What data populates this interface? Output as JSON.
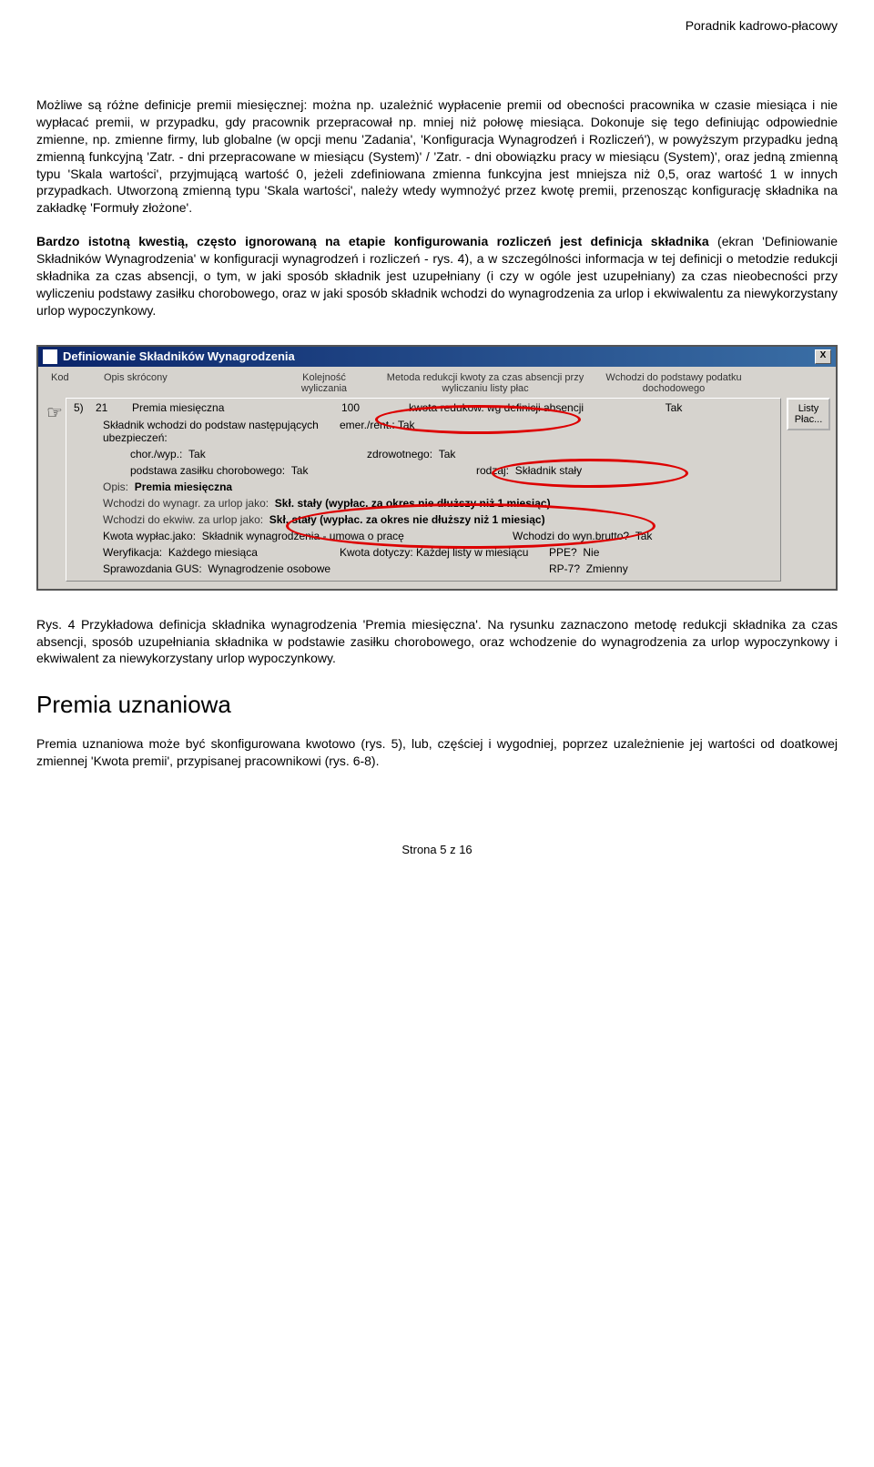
{
  "header": {
    "right": "Poradnik kadrowo-płacowy"
  },
  "para1": "Możliwe są różne definicje premii miesięcznej: można np. uzależnić wypłacenie premii od obecności pracownika w czasie miesiąca i nie wypłacać premii, w przypadku, gdy pracownik przepracował np. mniej niż połowę miesiąca. Dokonuje się tego definiując odpowiednie zmienne, np. zmienne firmy, lub globalne (w opcji menu 'Zadania', 'Konfiguracja Wynagrodzeń i Rozliczeń'), w powyższym przypadku jedną zmienną funkcyjną 'Zatr. - dni przepracowane w miesiącu (System)' / 'Zatr. - dni obowiązku pracy w miesiącu (System)', oraz jedną zmienną typu 'Skala wartości', przyjmującą wartość 0, jeżeli zdefiniowana zmienna funkcyjna jest mniejsza niż 0,5, oraz wartość 1 w innych przypadkach. Utworzoną zmienną typu 'Skala wartości', należy wtedy wymnożyć przez kwotę premii, przenosząc konfigurację składnika na zakładkę 'Formuły złożone'.",
  "para2_b": "Bardzo istotną kwestią, często ignorowaną na etapie konfigurowania rozliczeń jest definicja składnika",
  "para2_r": " (ekran 'Definiowanie Składników Wynagrodzenia' w konfiguracji wynagrodzeń i rozliczeń - rys. 4), a w szczególności informacja w tej definicji o metodzie redukcji składnika za czas absencji, o tym, w jaki sposób składnik jest uzupełniany (i czy w ogóle jest uzupełniany) za czas nieobecności przy wyliczeniu podstawy zasiłku chorobowego, oraz w jaki sposób składnik wchodzi do wynagrodzenia za urlop i ekwiwalentu za niewykorzystany urlop wypoczynkowy.",
  "win": {
    "title": "Definiowanie Składników Wynagrodzenia",
    "sys_close": "X",
    "cols": {
      "c1": "Kod",
      "c2": "Opis skrócony",
      "c3": "Kolejność wyliczania",
      "c4": "Metoda redukcji kwoty za czas absencji przy wyliczaniu listy płac",
      "c5": "Wchodzi do podstawy podatku dochodowego"
    },
    "row": {
      "idx": "5)",
      "kod": "21",
      "opis": "Premia miesięczna",
      "kol": "100",
      "met": "kwota redukow. wg definicji absencji",
      "pod": "Tak"
    },
    "l_ubez": "Składnik wchodzi do podstaw następujących ubezpieczeń:",
    "l_emer": "emer./rent.:",
    "v_emer": "Tak",
    "l_chor": "chor./wyp.:",
    "v_chor": "Tak",
    "l_zdr": "zdrowotnego:",
    "v_zdr": "Tak",
    "l_podst": "podstawa zasiłku chorobowego:",
    "v_podst": "Tak",
    "l_rodz": "rodzaj:",
    "v_rodz": "Składnik stały",
    "l_opis": "Opis:",
    "v_opis": "Premia miesięczna",
    "l_wurl": "Wchodzi do wynagr. za urlop jako:",
    "v_wurl": "Skł. stały (wypłac. za okres nie dłuższy niż 1 miesiąc)",
    "l_wekw": "Wchodzi do ekwiw. za urlop jako:",
    "v_wekw": "Skł. stały (wypłac. za okres nie dłuższy niż 1 miesiąc)",
    "l_kwyp": "Kwota wypłac.jako:",
    "v_kwyp": "Składnik wynagrodzenia - umowa o pracę",
    "l_wbr": "Wchodzi do wyn.brutto?",
    "v_wbr": "Tak",
    "l_wer": "Weryfikacja:",
    "v_wer": "Każdego miesiąca",
    "l_kwd": "Kwota dotyczy:",
    "v_kwd": "Każdej listy w miesiącu",
    "l_ppe": "PPE?",
    "v_ppe": "Nie",
    "l_gus": "Sprawozdania GUS:",
    "v_gus": "Wynagrodzenie osobowe",
    "l_rp7": "RP-7?",
    "v_rp7": "Zmienny",
    "btn_lp": "Listy Płac..."
  },
  "caption": "Rys. 4 Przykładowa definicja składnika wynagrodzenia 'Premia miesięczna'. Na rysunku zaznaczono metodę redukcji składnika za czas absencji, sposób uzupełniania składnika w podstawie zasiłku chorobowego, oraz wchodzenie do wynagrodzenia za urlop wypoczynkowy i ekwiwalent za niewykorzystany urlop wypoczynkowy.",
  "h2": "Premia uznaniowa",
  "para3": "Premia uznaniowa może być skonfigurowana kwotowo (rys. 5), lub, częściej i wygodniej, poprzez uzależnienie jej wartości od doatkowej zmiennej 'Kwota premii', przypisanej pracownikowi (rys. 6-8).",
  "footer": "Strona 5 z 16"
}
